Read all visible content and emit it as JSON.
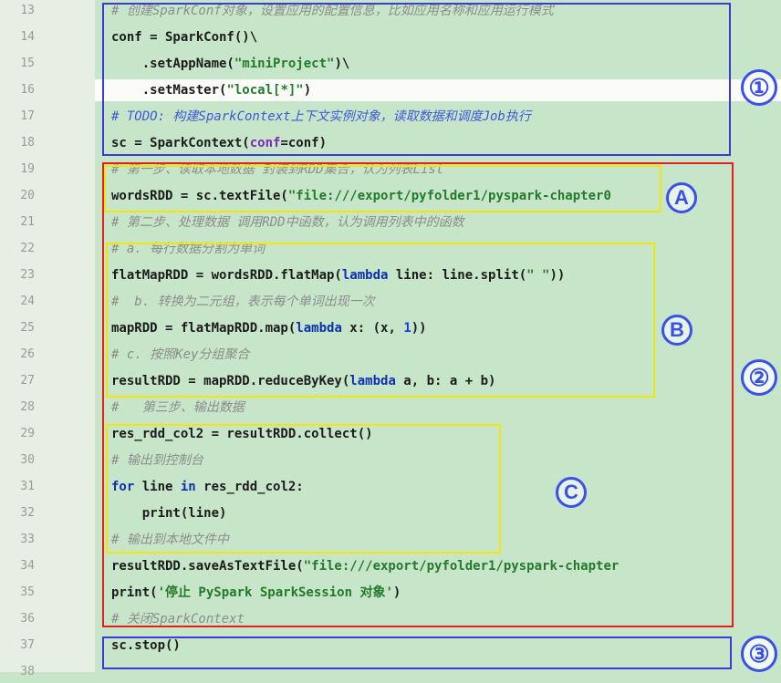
{
  "line_numbers": [
    "13",
    "14",
    "15",
    "16",
    "17",
    "18",
    "19",
    "20",
    "21",
    "22",
    "23",
    "24",
    "25",
    "26",
    "27",
    "28",
    "29",
    "30",
    "31",
    "32",
    "33",
    "34",
    "35",
    "36",
    "37",
    "38"
  ],
  "code": {
    "l13": "# 创建SparkConf对象，设置应用的配置信息，比如应用名称和应用运行模式",
    "l14": "conf = SparkConf()\\",
    "l15_a": "    .setAppName(",
    "l15_s": "\"miniProject\"",
    "l15_b": ")\\",
    "l16_a": "    .setMaster(",
    "l16_s": "\"local[*]\"",
    "l16_b": ")",
    "l17": "# TODO: 构建SparkContext上下文实例对象，读取数据和调度Job执行",
    "l18_a": "sc = SparkContext(",
    "l18_p": "conf",
    "l18_b": "=conf)",
    "l19": "# 第一步、读取本地数据 封装到RDD集合，认为列表List",
    "l20_a": "wordsRDD = sc.textFile(",
    "l20_s": "\"file:///export/pyfolder1/pyspark-chapter0",
    "l21": "# 第二步、处理数据 调用RDD中函数，认为调用列表中的函数",
    "l22": "# a. 每行数据分割为单词",
    "l23_a": "flatMapRDD = wordsRDD.flatMap(",
    "l23_k": "lambda",
    "l23_b": " line: line.split(",
    "l23_s": "\" \"",
    "l23_c": "))",
    "l24": "#  b. 转换为二元组，表示每个单词出现一次",
    "l25_a": "mapRDD = flatMapRDD.map(",
    "l25_k": "lambda",
    "l25_b": " x: (x, ",
    "l25_n": "1",
    "l25_c": "))",
    "l26": "# c. 按照Key分组聚合",
    "l27_a": "resultRDD = mapRDD.reduceByKey(",
    "l27_k": "lambda",
    "l27_b": " a, b: a + b)",
    "l28": "#   第三步、输出数据",
    "l29": "res_rdd_col2 = resultRDD.collect()",
    "l30": "# 输出到控制台",
    "l31_k": "for",
    "l31_b": " line ",
    "l31_k2": "in",
    "l31_c": " res_rdd_col2:",
    "l32": "    print(line)",
    "l33": "# 输出到本地文件中",
    "l34_a": "resultRDD.saveAsTextFile(",
    "l34_s": "\"file:///export/pyfolder1/pyspark-chapter",
    "l35_a": "print(",
    "l35_s": "'停止 PySpark SparkSession 对象'",
    "l35_b": ")",
    "l36": "# 关闭SparkContext",
    "l37": "sc.stop()"
  },
  "annotations": {
    "badge1": "①",
    "badge2": "②",
    "badge3": "③",
    "badgeA": "A",
    "badgeB": "B",
    "badgeC": "C"
  },
  "colors": {
    "background": "#c7e6c9",
    "blue_box": "#3b3bd8",
    "red_box": "#e51e1e",
    "yellow_box": "#f2e60c",
    "badge": "#3a50e8"
  }
}
